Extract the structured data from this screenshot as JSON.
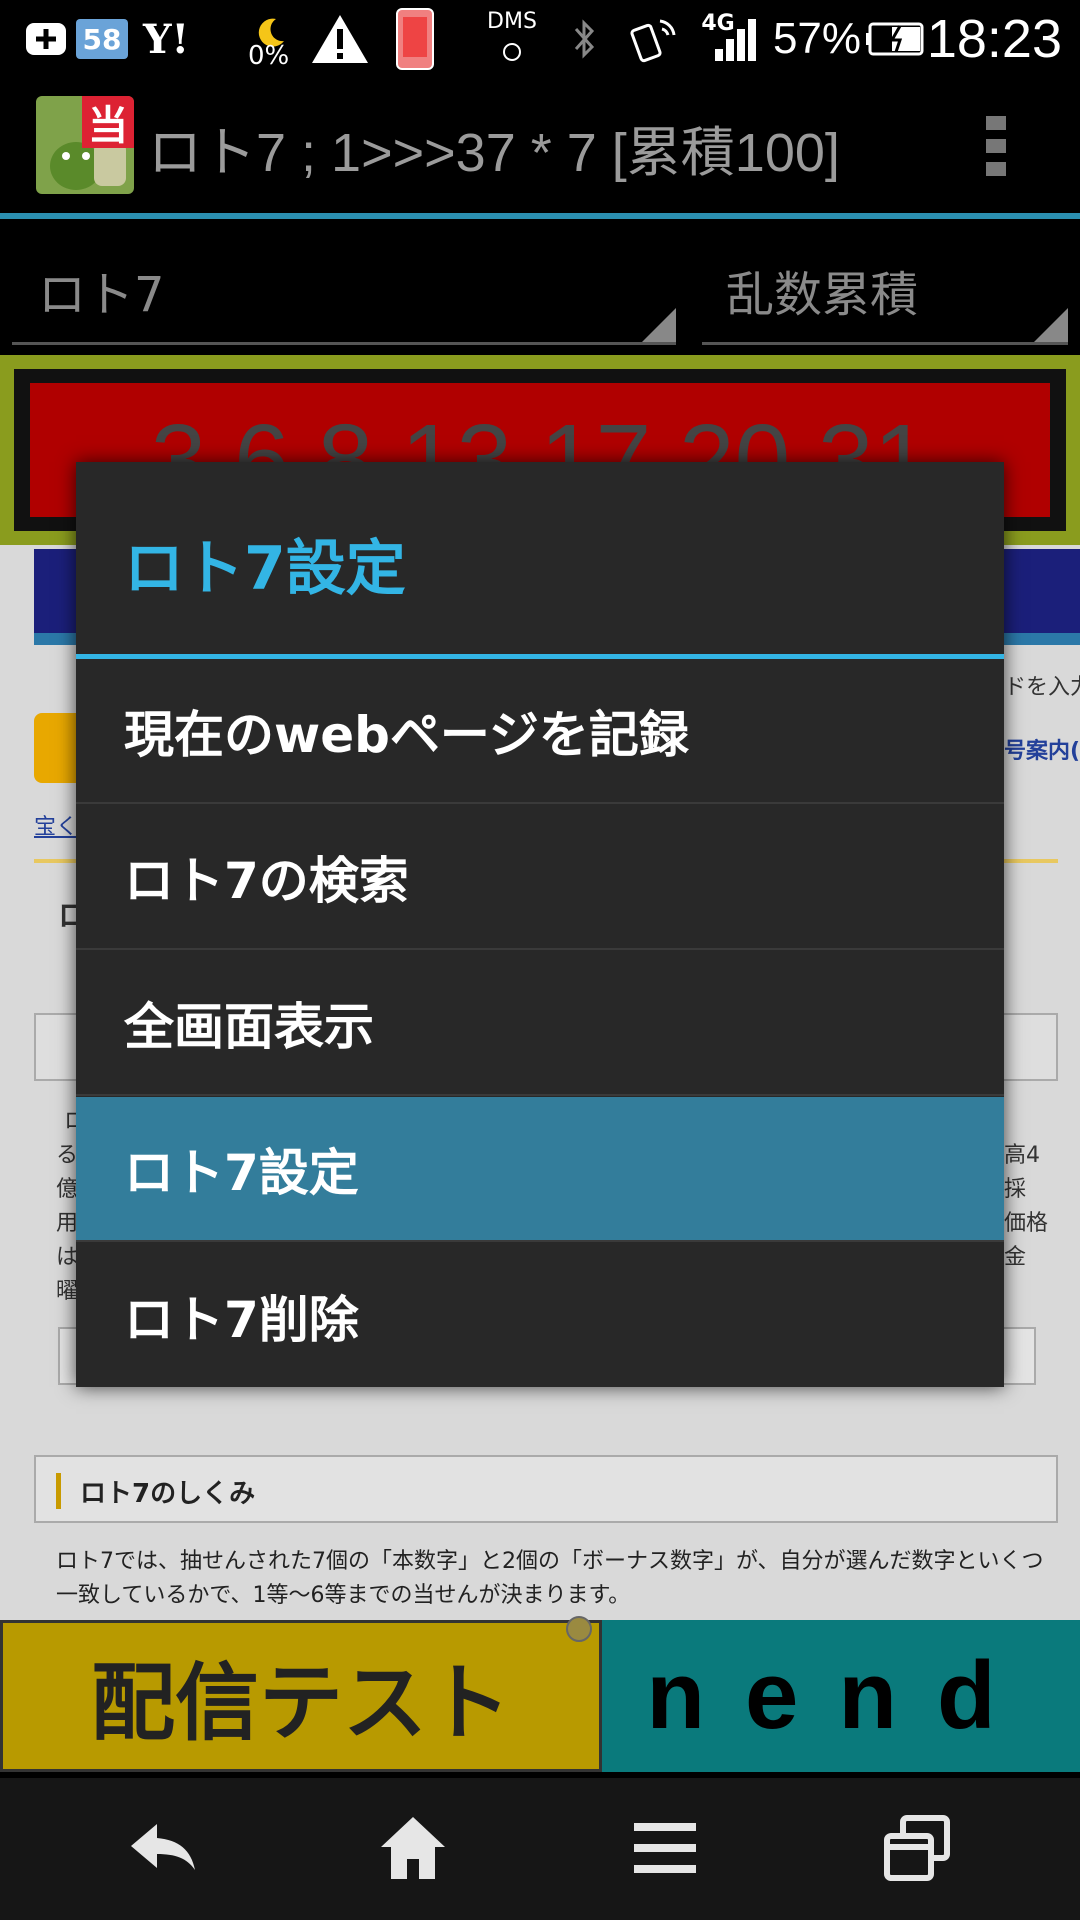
{
  "status_bar": {
    "time": "18:23",
    "battery_percent": "57%",
    "weather_percent": "0%",
    "dms_label": "DMS",
    "network_label": "4G",
    "counter_badge": "58",
    "yahoo_label": "Y!"
  },
  "action_bar": {
    "app_icon_badge": "当",
    "title": "ロト7 ; 1>>>37 * 7 [累積100]"
  },
  "spinners": {
    "lottery_type": "ロト7",
    "mode": "乱数累積"
  },
  "numbers_display": "3 6 8 13 17 20 31",
  "webpage": {
    "frag_right_1": "ドを入力",
    "frag_right_2": "号案内(",
    "frag_link": "宝く",
    "frag_left_1": "ロ",
    "frag_left_2": "る",
    "frag_left_3": "億",
    "frag_left_4": "用",
    "frag_left_5": "は",
    "frag_left_6": "曜",
    "frag_r_a": "高4",
    "frag_r_b": "採",
    "frag_r_c": "価格",
    "frag_r_d": "金",
    "section_heading": "ロト7のしくみ",
    "paragraph": "ロト7では、抽せんされた7個の「本数字」と2個の「ボーナス数字」が、自分が選んだ数字といくつ一致しているかで、1等〜6等までの当せんが決まります。"
  },
  "ads": {
    "left_text": "配信テスト",
    "right_text": "nend"
  },
  "dialog": {
    "title": "ロト7設定",
    "items": [
      {
        "label": "現在のwebページを記録"
      },
      {
        "label": "ロト7の検索"
      },
      {
        "label": "全画面表示"
      },
      {
        "label": "ロト7設定"
      },
      {
        "label": "ロト7削除"
      }
    ],
    "selected_item": "ロト7設定"
  },
  "colors": {
    "accent": "#33b5e5",
    "selected_row": "#337d9b",
    "dialog_bg": "#282828",
    "display_red": "#b00000"
  },
  "icons": {
    "nav": [
      "back-icon",
      "home-icon",
      "menu-icon",
      "recent-apps-icon"
    ]
  }
}
